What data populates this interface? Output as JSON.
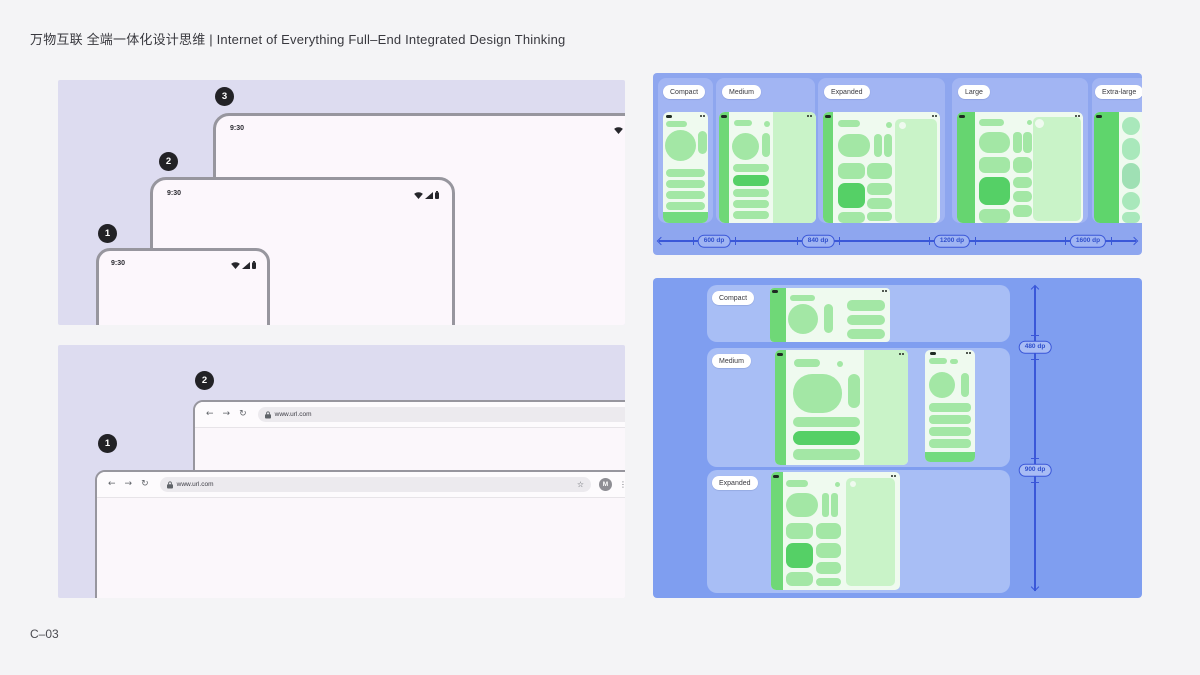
{
  "page": {
    "title": "万物互联 全端一体化设计思维 | Internet of Everything Full–End Integrated Design Thinking",
    "footer_code": "C–03"
  },
  "device_stack": {
    "items": [
      {
        "badge": "3",
        "time": "9:30"
      },
      {
        "badge": "2",
        "time": "9:30"
      },
      {
        "badge": "1",
        "time": "9:30"
      }
    ]
  },
  "browser_stack": {
    "items": [
      {
        "badge": "2",
        "url": "www.url.com"
      },
      {
        "badge": "1",
        "url": "www.url.com",
        "avatar": "M"
      }
    ]
  },
  "width_classes": {
    "labels": [
      "Compact",
      "Medium",
      "Expanded",
      "Large",
      "Extra-large"
    ],
    "breakpoints": [
      "600 dp",
      "840 dp",
      "1200 dp",
      "1600 dp"
    ]
  },
  "height_classes": {
    "labels": [
      "Compact",
      "Medium",
      "Expanded"
    ],
    "breakpoints": [
      "480 dp",
      "900 dp"
    ]
  },
  "colors": {
    "page_bg": "#F4F4F6",
    "panel_lavender": "#DDDCF0",
    "panel_blue": "#8EA6EF",
    "panel_blue_deep": "#7F9EF0",
    "card_blue": "#A2B5F3",
    "mock_bg": "#EFFAEF",
    "green_light": "#A3E7A5",
    "green_rail": "#6FD877",
    "green_dark": "#55D066",
    "green_pane": "#C9F3C8",
    "measure_blue": "#3A57D8",
    "frame_border": "#97969E"
  }
}
